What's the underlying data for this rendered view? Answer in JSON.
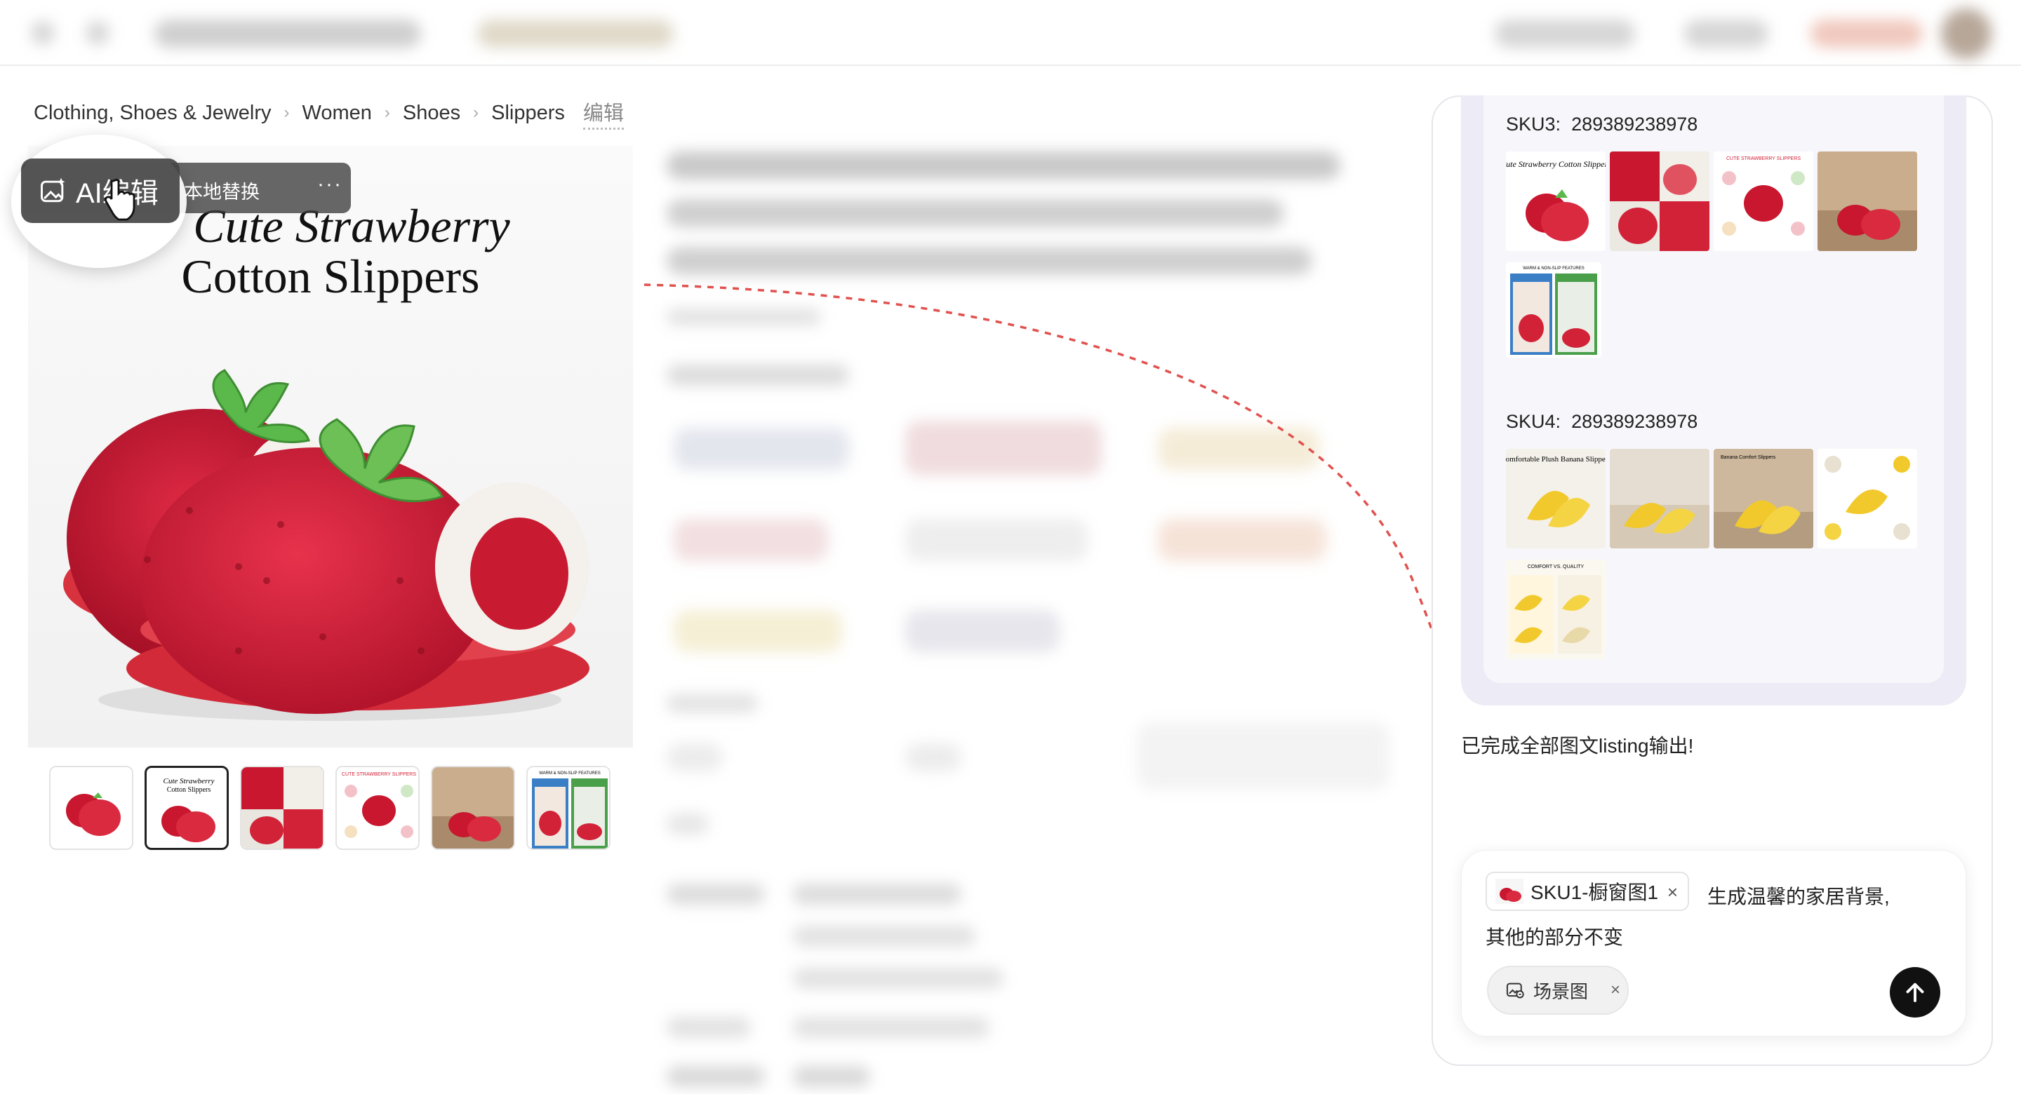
{
  "breadcrumb": {
    "items": [
      "Clothing, Shoes & Jewelry",
      "Women",
      "Shoes",
      "Slippers"
    ],
    "edit_label": "编辑"
  },
  "main_image": {
    "title_line1": "Cute Strawberry",
    "title_line2": "Cotton Slippers"
  },
  "toolbar": {
    "ai_edit_label": "AI编辑",
    "local_replace_label": "本地替换",
    "more_label": "···"
  },
  "thumbnails": {
    "count": 6,
    "active_index": 1
  },
  "panel": {
    "sku3": {
      "label": "SKU3:",
      "id": "289389238978",
      "image_texts": [
        "Cute Strawberry Cotton Slippers",
        "",
        "CUTE STRAWBERRY SLIPPERS",
        "",
        "WARM & NON-SLIP FEATURES"
      ]
    },
    "sku4": {
      "label": "SKU4:",
      "id": "289389238978",
      "image_texts": [
        "Comfortable Plush Banana Slippers",
        "",
        "Banana Comfort Slippers",
        "",
        "COMFORT VS. QUALITY"
      ]
    },
    "done_text": "已完成全部图文listing输出!",
    "input": {
      "chip_label": "SKU1-橱窗图1",
      "chip_close": "×",
      "prompt_line1": "生成温馨的家居背景,",
      "prompt_line2": "其他的部分不变",
      "scene_tag": "场景图",
      "scene_close": "×"
    }
  },
  "colors": {
    "strawberry_red": "#d81e3a",
    "leaf_green": "#5bb84a",
    "banana_yellow": "#f2c92c",
    "arrow_red": "#e0524f",
    "panel_lavender": "#ecebf6",
    "send_button": "#111111"
  },
  "icons": [
    "ai-image-icon",
    "pointer-cursor-icon",
    "chevron-right-icon",
    "close-icon",
    "scene-image-icon",
    "arrow-up-icon"
  ]
}
